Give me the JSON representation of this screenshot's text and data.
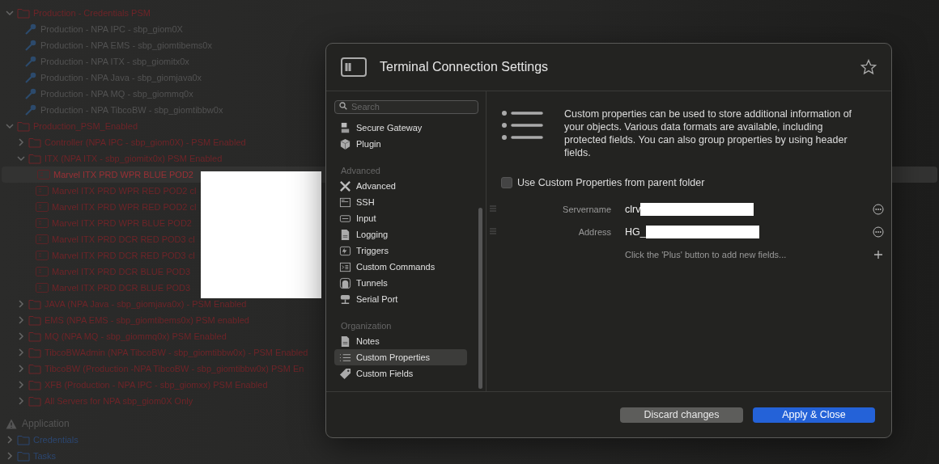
{
  "tree": {
    "nodes": [
      {
        "kind": "folder",
        "label": "Production - Credentials PSM",
        "color": "#6e2428",
        "expanded": true,
        "children": [
          {
            "kind": "credential",
            "label": "Production - NPA  IPC - sbp_giom0X"
          },
          {
            "kind": "credential",
            "label": "Production - NPA EMS - sbp_giomtibems0x"
          },
          {
            "kind": "credential",
            "label": "Production - NPA ITX - sbp_giomitx0x"
          },
          {
            "kind": "credential",
            "label": "Production - NPA Java - sbp_giomjava0x"
          },
          {
            "kind": "credential",
            "label": "Production - NPA  MQ - sbp_giommq0x"
          },
          {
            "kind": "credential",
            "label": "Production - NPA TibcoBW - sbp_giomtibbw0x"
          }
        ]
      },
      {
        "kind": "folder",
        "label": "Production_PSM_Enabled",
        "color": "#6e2428",
        "expanded": true,
        "children": [
          {
            "kind": "folder",
            "label": "Controller (NPA  IPC - sbp_giom0X) - PSM Enabled",
            "color": "#6e2428",
            "expanded": false
          },
          {
            "kind": "folder",
            "label": "ITX (NPA ITX - sbp_giomitx0x) PSM Enabled",
            "color": "#6e2428",
            "expanded": true,
            "children": [
              {
                "kind": "connection",
                "label": "Marvel ITX PRD WPR BLUE POD2",
                "color": "#9a3035",
                "selected": true
              },
              {
                "kind": "connection",
                "label": "Marvel ITX PRD WPR RED POD2 cl",
                "color": "#6e2428",
                "selected": false
              },
              {
                "kind": "connection",
                "label": "Marvel ITX PRD WPR RED POD2 cl",
                "color": "#6e2428",
                "selected": false
              },
              {
                "kind": "connection",
                "label": "Marvel ITX PRD WPR BLUE POD2",
                "color": "#6e2428",
                "selected": false
              },
              {
                "kind": "connection",
                "label": "Marvel ITX PRD DCR RED POD3 cl",
                "color": "#6e2428",
                "selected": false
              },
              {
                "kind": "connection",
                "label": "Marvel ITX PRD DCR RED POD3 cl",
                "color": "#6e2428",
                "selected": false
              },
              {
                "kind": "connection",
                "label": "Marvel ITX PRD DCR BLUE POD3",
                "color": "#6e2428",
                "selected": false
              },
              {
                "kind": "connection",
                "label": "Marvel ITX PRD DCR BLUE POD3",
                "color": "#6e2428",
                "selected": false
              }
            ]
          },
          {
            "kind": "folder",
            "label": "JAVA (NPA Java - sbp_giomjava0x) - PSM Enabled",
            "color": "#6e2428",
            "expanded": false
          },
          {
            "kind": "folder",
            "label": "EMS (NPA EMS - sbp_giomtibems0x) PSM enabled",
            "color": "#6e2428",
            "expanded": false
          },
          {
            "kind": "folder",
            "label": "MQ (NPA MQ - sbp_giommq0x) PSM Enabled",
            "color": "#6e2428",
            "expanded": false
          },
          {
            "kind": "folder",
            "label": "TibcoBWAdmin (NPA TibcoBW - sbp_giomtibbw0x) - PSM Enabled",
            "color": "#6e2428",
            "expanded": false
          },
          {
            "kind": "folder",
            "label": "TibcoBW (Production -NPA TibcoBW - sbp_giomtibbw0x) PSM En",
            "color": "#6e2428",
            "expanded": false
          },
          {
            "kind": "folder",
            "label": "XFB (Production - NPA IPC - sbp_giomxx) PSM Enabled",
            "color": "#6e2428",
            "expanded": false
          },
          {
            "kind": "folder",
            "label": "All Servers for NPA sbp_giom0X Only",
            "color": "#6e2428",
            "expanded": false
          }
        ]
      }
    ]
  },
  "application": {
    "title": "Application",
    "nodes": [
      {
        "kind": "folder",
        "label": "Credentials",
        "color": "#2b4670",
        "expanded": false
      },
      {
        "kind": "folder",
        "label": "Tasks",
        "color": "#2b4670",
        "expanded": false
      }
    ]
  },
  "dialog": {
    "title": "Terminal Connection Settings",
    "sidebar": {
      "search": {
        "placeholder": "Search"
      },
      "groups": [
        {
          "items": [
            {
              "label": "Secure Gateway",
              "selected": false
            },
            {
              "label": "Plugin",
              "selected": false
            }
          ]
        },
        {
          "title": "Advanced",
          "items": [
            {
              "label": "Advanced",
              "selected": false
            },
            {
              "label": "SSH",
              "selected": false
            },
            {
              "label": "Input",
              "selected": false
            },
            {
              "label": "Logging",
              "selected": false
            },
            {
              "label": "Triggers",
              "selected": false
            },
            {
              "label": "Custom Commands",
              "selected": false
            },
            {
              "label": "Tunnels",
              "selected": false
            },
            {
              "label": "Serial Port",
              "selected": false
            }
          ]
        },
        {
          "title": "Organization",
          "items": [
            {
              "label": "Notes",
              "selected": false
            },
            {
              "label": "Custom Properties",
              "selected": true
            },
            {
              "label": "Custom Fields",
              "selected": false
            }
          ]
        }
      ]
    },
    "description": "Custom properties can be used to store additional information of your objects. Various data formats are available, including protected fields. You can also group properties by using header fields.",
    "inherit": {
      "label": "Use Custom Properties from parent folder",
      "checked": false
    },
    "fields": [
      {
        "label": "Servername",
        "value": "clrv"
      },
      {
        "label": "Address",
        "value": "HG_"
      }
    ],
    "hint": "Click the 'Plus' button to add new fields...",
    "buttons": [
      {
        "label": "Discard changes",
        "kind": "secondary"
      },
      {
        "label": "Apply & Close",
        "kind": "primary"
      }
    ]
  }
}
